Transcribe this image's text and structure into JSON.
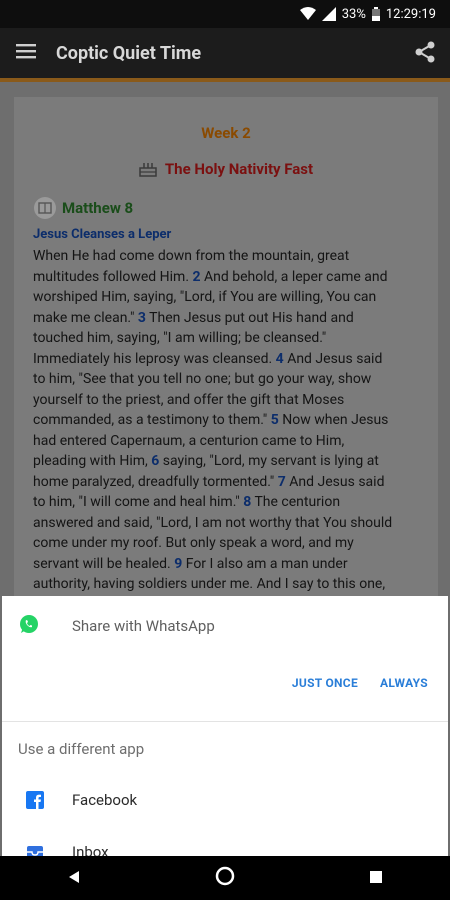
{
  "status": {
    "battery": "33%",
    "time": "12:29:19"
  },
  "app": {
    "title": "Coptic Quiet Time"
  },
  "content": {
    "week": "Week 2",
    "fast": "The Holy Nativity Fast",
    "chapter": "Matthew 8",
    "heading": "Jesus Cleanses a Leper",
    "lines": [
      [
        {
          "t": "When He had come down from the mountain, great"
        }
      ],
      [
        {
          "t": "multitudes followed Him. "
        },
        {
          "v": "2"
        },
        {
          "t": " And behold, a leper came and"
        }
      ],
      [
        {
          "t": "worshiped Him, saying, \"Lord, if You are willing, You can"
        }
      ],
      [
        {
          "t": "make me clean.\" "
        },
        {
          "v": "3"
        },
        {
          "t": " Then Jesus put out His hand and"
        }
      ],
      [
        {
          "t": "touched him, saying, \"I am willing; be cleansed.\""
        }
      ],
      [
        {
          "t": "Immediately his leprosy was cleansed. "
        },
        {
          "v": "4"
        },
        {
          "t": " And Jesus said"
        }
      ],
      [
        {
          "t": "to him, \"See that you tell no one; but go your way, show"
        }
      ],
      [
        {
          "t": "yourself to the priest, and offer the gift that Moses"
        }
      ],
      [
        {
          "t": "commanded, as a testimony to them.\" "
        },
        {
          "v": "5"
        },
        {
          "t": " Now when Jesus"
        }
      ],
      [
        {
          "t": "had entered Capernaum, a centurion came to Him,"
        }
      ],
      [
        {
          "t": "pleading with Him, "
        },
        {
          "v": "6"
        },
        {
          "t": " saying, \"Lord, my servant is lying at"
        }
      ],
      [
        {
          "t": "home paralyzed, dreadfully tormented.\" "
        },
        {
          "v": "7"
        },
        {
          "t": " And Jesus said"
        }
      ],
      [
        {
          "t": "to him, \"I will come and heal him.\" "
        },
        {
          "v": "8"
        },
        {
          "t": " The centurion"
        }
      ],
      [
        {
          "t": "answered and said, \"Lord, I am not worthy that You should"
        }
      ],
      [
        {
          "t": "come under my roof. But only speak a word, and my"
        }
      ],
      [
        {
          "t": "servant will be healed. "
        },
        {
          "v": "9"
        },
        {
          "t": " For I also am a man under"
        }
      ],
      [
        {
          "t": "authority, having soldiers under me. And I say to this one,"
        }
      ]
    ]
  },
  "sheet": {
    "share_label": "Share with WhatsApp",
    "just_once": "JUST ONCE",
    "always": "ALWAYS",
    "different_app": "Use a different app",
    "apps": [
      {
        "name": "Facebook",
        "icon": "facebook-icon"
      },
      {
        "name": "Inbox",
        "icon": "inbox-icon"
      }
    ]
  },
  "colors": {
    "accent": "#2a7ed8",
    "whatsapp": "#25d366",
    "facebook": "#1877f2"
  }
}
